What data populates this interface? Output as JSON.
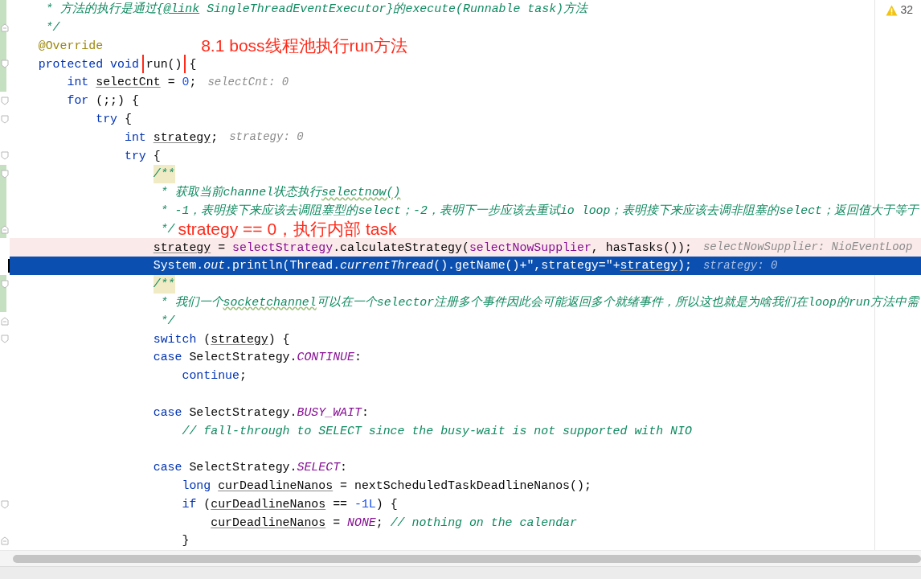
{
  "warnings": {
    "count": "32"
  },
  "lines": [
    {
      "changed": true,
      "tokens": [
        {
          "kind": "comment",
          "text": "     * 方法的执行是通过{"
        },
        {
          "kind": "doctag",
          "text": "@link"
        },
        {
          "kind": "comment",
          "text": " SingleThreadEventExecutor}的execute(Runnable task)方法"
        }
      ]
    },
    {
      "changed": true,
      "fold_end": true,
      "tokens": [
        {
          "kind": "comment",
          "text": "     */"
        }
      ]
    },
    {
      "changed": true,
      "tokens": [
        {
          "kind": "annotation",
          "text": "    @Override"
        },
        {
          "kind": "callout",
          "text": "8.1 boss线程池执行run方法"
        }
      ]
    },
    {
      "changed": true,
      "fold_start": true,
      "tokens": [
        {
          "kind": "kw",
          "text": "    protected void "
        },
        {
          "kind": "boxed",
          "text": "run()"
        },
        {
          "kind": "plain",
          "text": " {"
        }
      ]
    },
    {
      "changed": true,
      "tokens": [
        {
          "kind": "kw",
          "text": "        int "
        },
        {
          "kind": "var",
          "text": "selectCnt"
        },
        {
          "kind": "plain",
          "text": " = "
        },
        {
          "kind": "num",
          "text": "0"
        },
        {
          "kind": "plain",
          "text": ";"
        },
        {
          "kind": "hint",
          "text": "selectCnt: 0"
        }
      ]
    },
    {
      "changed": false,
      "fold_start": true,
      "tokens": [
        {
          "kind": "kw",
          "text": "        for"
        },
        {
          "kind": "plain",
          "text": " (;;) {"
        }
      ]
    },
    {
      "changed": false,
      "fold_start": true,
      "tokens": [
        {
          "kind": "kw",
          "text": "            try"
        },
        {
          "kind": "plain",
          "text": " {"
        }
      ]
    },
    {
      "changed": false,
      "tokens": [
        {
          "kind": "kw",
          "text": "                int "
        },
        {
          "kind": "var",
          "text": "strategy"
        },
        {
          "kind": "plain",
          "text": ";"
        },
        {
          "kind": "hint",
          "text": "strategy: 0"
        }
      ]
    },
    {
      "changed": false,
      "fold_start": true,
      "tokens": [
        {
          "kind": "kw",
          "text": "                try"
        },
        {
          "kind": "plain",
          "text": " {"
        }
      ]
    },
    {
      "changed": true,
      "fold_start": true,
      "tokens": [
        {
          "kind": "marked",
          "text": "                    /**"
        }
      ]
    },
    {
      "changed": true,
      "tokens": [
        {
          "kind": "comment",
          "text": "                     * 获取当前channel状态执行"
        },
        {
          "kind": "typo",
          "text": "selectnow()"
        }
      ]
    },
    {
      "changed": true,
      "tokens": [
        {
          "kind": "comment",
          "text": "                     * -1，表明接下来应该去调阻塞型的select；-2，表明下一步应该去重试io loop；表明接下来应该去调非阻塞的select；返回值大于等于"
        }
      ]
    },
    {
      "changed": true,
      "fold_end": true,
      "tokens": [
        {
          "kind": "comment",
          "text": "                     */"
        },
        {
          "kind": "note",
          "text": "strategy == 0，执行内部 task"
        }
      ]
    },
    {
      "changed": false,
      "kind": "breakpoint",
      "tokens": [
        {
          "kind": "var",
          "text": "                    strategy"
        },
        {
          "kind": "plain",
          "text": " = "
        },
        {
          "kind": "field",
          "text": "selectStrategy"
        },
        {
          "kind": "plain",
          "text": ".calculateStrategy("
        },
        {
          "kind": "field",
          "text": "selectNowSupplier"
        },
        {
          "kind": "plain",
          "text": ", hasTasks());"
        },
        {
          "kind": "hint",
          "text": "selectNowSupplier: NioEventLoop"
        }
      ]
    },
    {
      "changed": false,
      "kind": "execution",
      "tokens": [
        {
          "kind": "plain",
          "text": "                    System."
        },
        {
          "kind": "italic",
          "text": "out"
        },
        {
          "kind": "plain",
          "text": ".println(Thread."
        },
        {
          "kind": "italic",
          "text": "currentThread"
        },
        {
          "kind": "plain",
          "text": "().getName()+"
        },
        {
          "kind": "string",
          "text": "\",strategy=\""
        },
        {
          "kind": "plain",
          "text": "+"
        },
        {
          "kind": "var",
          "text": "strategy"
        },
        {
          "kind": "plain",
          "text": ");"
        },
        {
          "kind": "hint",
          "text": "strategy: 0"
        }
      ]
    },
    {
      "changed": true,
      "fold_start": true,
      "tokens": [
        {
          "kind": "marked",
          "text": "                    /**"
        }
      ]
    },
    {
      "changed": true,
      "tokens": [
        {
          "kind": "comment",
          "text": "                     * 我们一个"
        },
        {
          "kind": "typo",
          "text": "socketchannel"
        },
        {
          "kind": "comment",
          "text": "可以在一个selector注册多个事件因此会可能返回多个就绪事件，所以这也就是为啥我们在loop的run方法中需"
        }
      ]
    },
    {
      "changed": false,
      "fold_end": true,
      "tokens": [
        {
          "kind": "comment",
          "text": "                     */"
        }
      ]
    },
    {
      "changed": false,
      "fold_start": true,
      "tokens": [
        {
          "kind": "kw",
          "text": "                    switch"
        },
        {
          "kind": "plain",
          "text": " ("
        },
        {
          "kind": "var",
          "text": "strategy"
        },
        {
          "kind": "plain",
          "text": ") {"
        }
      ]
    },
    {
      "changed": false,
      "tokens": [
        {
          "kind": "kw",
          "text": "                    case"
        },
        {
          "kind": "plain",
          "text": " SelectStrategy."
        },
        {
          "kind": "static",
          "text": "CONTINUE"
        },
        {
          "kind": "plain",
          "text": ":"
        }
      ]
    },
    {
      "changed": false,
      "tokens": [
        {
          "kind": "kw",
          "text": "                        continue"
        },
        {
          "kind": "plain",
          "text": ";"
        }
      ]
    },
    {
      "changed": false
    },
    {
      "changed": false,
      "tokens": [
        {
          "kind": "kw",
          "text": "                    case"
        },
        {
          "kind": "plain",
          "text": " SelectStrategy."
        },
        {
          "kind": "static",
          "text": "BUSY_WAIT"
        },
        {
          "kind": "plain",
          "text": ":"
        }
      ]
    },
    {
      "changed": false,
      "tokens": [
        {
          "kind": "comment",
          "text": "                        // fall-through to SELECT since the busy-wait is not supported with NIO"
        }
      ]
    },
    {
      "changed": false
    },
    {
      "changed": false,
      "tokens": [
        {
          "kind": "kw",
          "text": "                    case"
        },
        {
          "kind": "plain",
          "text": " SelectStrategy."
        },
        {
          "kind": "static",
          "text": "SELECT"
        },
        {
          "kind": "plain",
          "text": ":"
        }
      ]
    },
    {
      "changed": false,
      "tokens": [
        {
          "kind": "kw",
          "text": "                        long "
        },
        {
          "kind": "var",
          "text": "curDeadlineNanos"
        },
        {
          "kind": "plain",
          "text": " = nextScheduledTaskDeadlineNanos();"
        }
      ]
    },
    {
      "changed": false,
      "fold_start": true,
      "tokens": [
        {
          "kind": "kw",
          "text": "                        if"
        },
        {
          "kind": "plain",
          "text": " ("
        },
        {
          "kind": "var",
          "text": "curDeadlineNanos"
        },
        {
          "kind": "plain",
          "text": " == "
        },
        {
          "kind": "num",
          "text": "-1L"
        },
        {
          "kind": "plain",
          "text": ") {"
        }
      ]
    },
    {
      "changed": false,
      "tokens": [
        {
          "kind": "var",
          "text": "                            curDeadlineNanos"
        },
        {
          "kind": "plain",
          "text": " = "
        },
        {
          "kind": "static",
          "text": "NONE"
        },
        {
          "kind": "plain",
          "text": "; "
        },
        {
          "kind": "comment",
          "text": "// nothing on the calendar"
        }
      ]
    },
    {
      "changed": false,
      "fold_end": true,
      "tokens": [
        {
          "kind": "plain",
          "text": "                        }"
        }
      ]
    }
  ]
}
